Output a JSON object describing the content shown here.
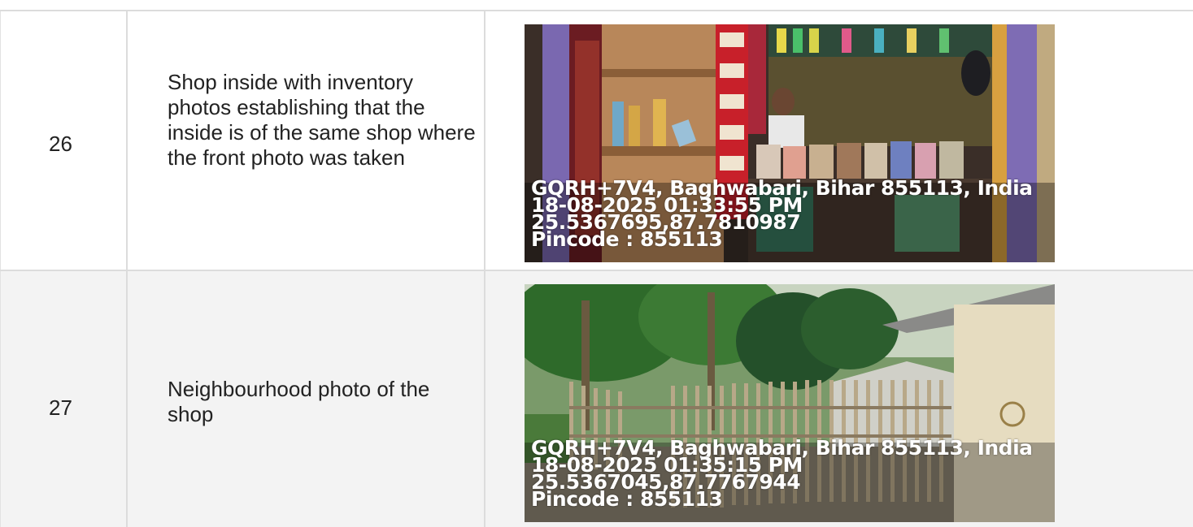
{
  "rows": [
    {
      "number": "26",
      "description": "Shop inside with inventory photos establishing that the inside is of the same shop where the front photo was taken",
      "stamp": {
        "address": "GQRH+7V4, Baghwabari, Bihar 855113, India",
        "datetime": "18-08-2025 01:33:55 PM",
        "coordinates": "25.5367695,87.7810987",
        "pincode": "Pincode : 855113"
      }
    },
    {
      "number": "27",
      "description": "Neighbourhood photo of the shop",
      "stamp": {
        "address": "GQRH+7V4, Baghwabari, Bihar 855113, India",
        "datetime": "18-08-2025 01:35:15 PM",
        "coordinates": "25.5367045,87.7767944",
        "pincode": "Pincode : 855113"
      }
    }
  ]
}
